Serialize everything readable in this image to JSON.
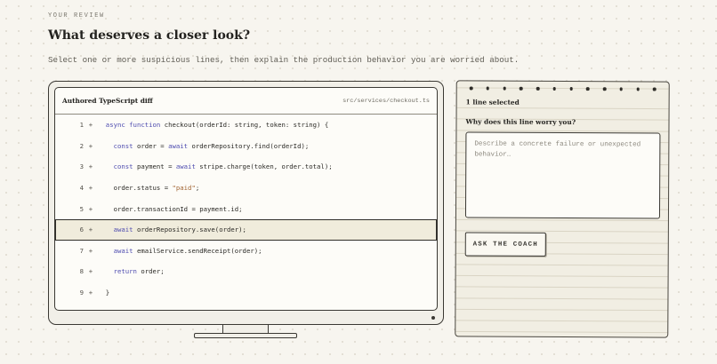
{
  "page": {
    "eyebrow": "YOUR REVIEW",
    "title": "What deserves a closer look?",
    "subtitle": "Select one or more suspicious lines, then explain the production behavior you are worried about."
  },
  "diff": {
    "title": "Authored TypeScript diff",
    "file_path": "src/services/checkout.ts",
    "selected_line": 6,
    "lines": [
      {
        "num": "1",
        "marker": "+",
        "indent": "  ",
        "kw": "async function",
        "rest": " checkout(orderId: string, token: string) {"
      },
      {
        "num": "2",
        "marker": "+",
        "indent": "    ",
        "kw": "const",
        "rest": " order = ",
        "kw2": "await",
        "rest2": " orderRepository.find(orderId);"
      },
      {
        "num": "3",
        "marker": "+",
        "indent": "    ",
        "kw": "const",
        "rest": " payment = ",
        "kw2": "await",
        "rest2": " stripe.charge(token, order.total);"
      },
      {
        "num": "4",
        "marker": "+",
        "indent": "    ",
        "plain": "order.status = ",
        "str": "\"paid\"",
        "rest": ";"
      },
      {
        "num": "5",
        "marker": "+",
        "indent": "    ",
        "plain": "order.transactionId = payment.id;"
      },
      {
        "num": "6",
        "marker": "+",
        "indent": "    ",
        "kw": "await",
        "rest": " orderRepository.save(order);"
      },
      {
        "num": "7",
        "marker": "+",
        "indent": "    ",
        "kw": "await",
        "rest": " emailService.sendReceipt(order);"
      },
      {
        "num": "8",
        "marker": "+",
        "indent": "    ",
        "kw": "return",
        "rest": " order;"
      },
      {
        "num": "9",
        "marker": "+",
        "indent": "  ",
        "plain": "}"
      }
    ]
  },
  "notepad": {
    "selection_count": "1 line selected",
    "question": "Why does this line worry you?",
    "answer_value": "",
    "answer_placeholder": "Describe a concrete failure or unexpected behavior…",
    "button_label": "ASK THE COACH"
  }
}
